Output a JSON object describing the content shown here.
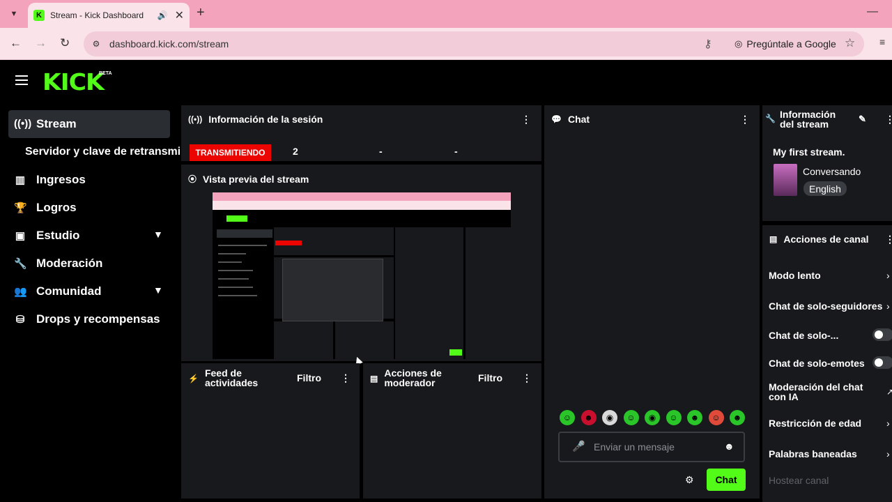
{
  "browser": {
    "tab_title": "Stream - Kick Dashboard",
    "url": "dashboard.kick.com/stream",
    "google_chip": "Pregúntale a Google"
  },
  "header": {
    "logo": "KICK",
    "beta": "BETA"
  },
  "sidebar": {
    "items": [
      {
        "label": "Stream",
        "icon": "broadcast-icon"
      },
      {
        "label": "Servidor y clave de retransmisión"
      },
      {
        "label": "Ingresos",
        "icon": "chart-icon"
      },
      {
        "label": "Logros",
        "icon": "trophy-icon"
      },
      {
        "label": "Estudio",
        "icon": "studio-icon"
      },
      {
        "label": "Moderación",
        "icon": "wrench-icon"
      },
      {
        "label": "Comunidad",
        "icon": "community-icon"
      },
      {
        "label": "Drops y recompensas",
        "icon": "drops-icon"
      }
    ]
  },
  "session": {
    "title": "Información de la sesión",
    "badge": "TRANSMITIENDO",
    "viewers": "2",
    "stat2": "-",
    "stat3": "-"
  },
  "preview": {
    "title": "Vista previa del stream"
  },
  "activity": {
    "title_line1": "Feed de",
    "title_line2": "actividades",
    "filter": "Filtro"
  },
  "mod_actions": {
    "title_line1": "Acciones de",
    "title_line2": "moderador",
    "filter": "Filtro"
  },
  "chat": {
    "title": "Chat",
    "placeholder": "Enviar un mensaje",
    "send": "Chat",
    "emotes": [
      "☺",
      "☻",
      "◉",
      "☺",
      "◉",
      "☺",
      "☻",
      "☺",
      "☻"
    ]
  },
  "stream_info": {
    "title_line1": "Información",
    "title_line2": "del stream",
    "name": "My first stream.",
    "category": "Conversando",
    "language": "English"
  },
  "channel_actions": {
    "title": "Acciones de canal",
    "rows": [
      {
        "label": "Modo lento"
      },
      {
        "label": "Chat de solo-seguidores"
      },
      {
        "label": "Chat de solo-..."
      },
      {
        "label": "Chat de solo-emotes"
      },
      {
        "label": "Moderación del chat",
        "label2": "con IA"
      },
      {
        "label": "Restricción de edad"
      },
      {
        "label": "Palabras baneadas"
      },
      {
        "label": "Hostear canal"
      }
    ]
  }
}
